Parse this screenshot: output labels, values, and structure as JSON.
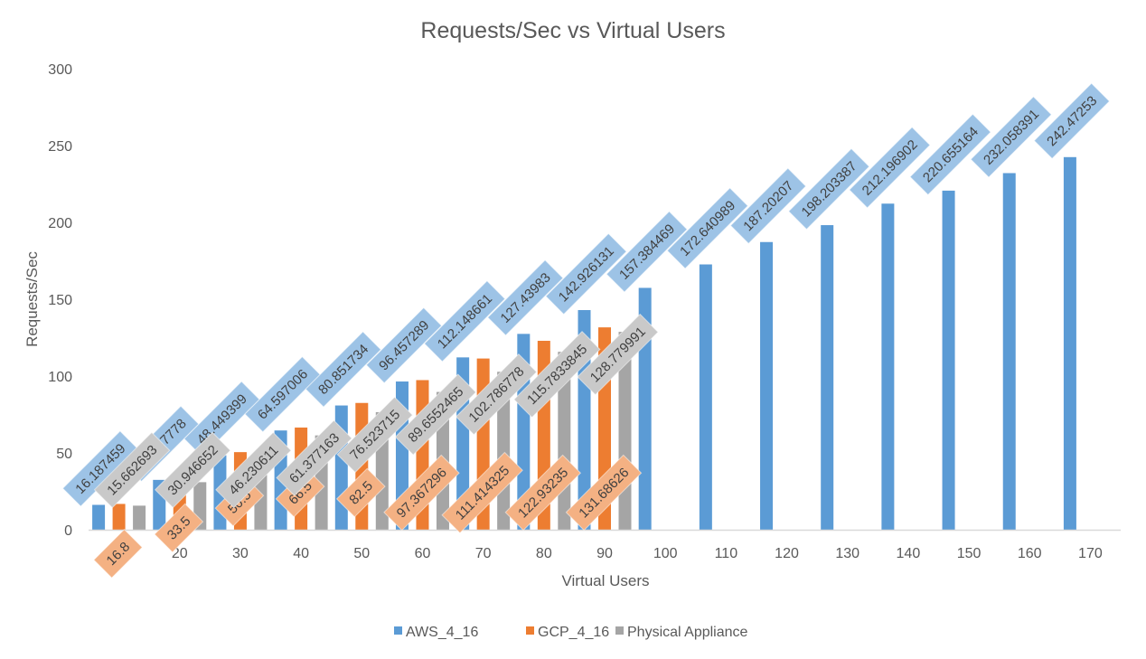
{
  "chart_data": {
    "type": "bar",
    "title": "Requests/Sec vs Virtual Users",
    "xlabel": "Virtual Users",
    "ylabel": "Requests/Sec",
    "ylim": [
      0,
      300
    ],
    "yticks": [
      "0",
      "50",
      "100",
      "150",
      "200",
      "250",
      "300"
    ],
    "grid": false,
    "legend_position": "bottom",
    "categories": [
      "10",
      "20",
      "30",
      "40",
      "50",
      "60",
      "70",
      "80",
      "90",
      "100",
      "110",
      "120",
      "130",
      "140",
      "150",
      "160",
      "170"
    ],
    "series": [
      {
        "name": "AWS_4_16",
        "color": "#5b9bd5",
        "label_bg": "#9dc3e6",
        "values": [
          16.187459,
          32.437778,
          48.449399,
          64.597006,
          80.851734,
          96.457289,
          112.148661,
          127.43983,
          142.926131,
          157.384469,
          172.640989,
          187.20207,
          198.203387,
          212.196902,
          220.655164,
          232.058391,
          242.47253
        ],
        "labels": [
          "16.187459",
          "32.437778",
          "48.449399",
          "64.597006",
          "80.851734",
          "96.457289",
          "112.148661",
          "127.43983",
          "142.926131",
          "157.384469",
          "172.640989",
          "187.20207",
          "198.203387",
          "212.196902",
          "220.655164",
          "232.058391",
          "242.47253"
        ]
      },
      {
        "name": "GCP_4_16",
        "color": "#ed7d31",
        "label_bg": "#f4b183",
        "values": [
          16.8,
          33.5,
          50.5,
          66.5,
          82.5,
          97.367296,
          111.414325,
          122.93235,
          131.68626
        ],
        "labels": [
          "16.8",
          "33.5",
          "50.5",
          "66.5",
          "82.5",
          "97.367296",
          "111.414325",
          "122.93235",
          "131.68626"
        ]
      },
      {
        "name": "Physical Appliance",
        "color": "#a5a5a5",
        "label_bg": "#c9c9c9",
        "values": [
          15.662693,
          30.946652,
          46.230611,
          61.377163,
          76.523715,
          89.6552465,
          102.786778,
          115.7833845,
          128.779991
        ],
        "labels": [
          "15.662693",
          "30.946652",
          "46.230611",
          "61.377163",
          "76.523715",
          "89.6552465",
          "102.786778",
          "115.7833845",
          "128.779991"
        ]
      }
    ]
  }
}
